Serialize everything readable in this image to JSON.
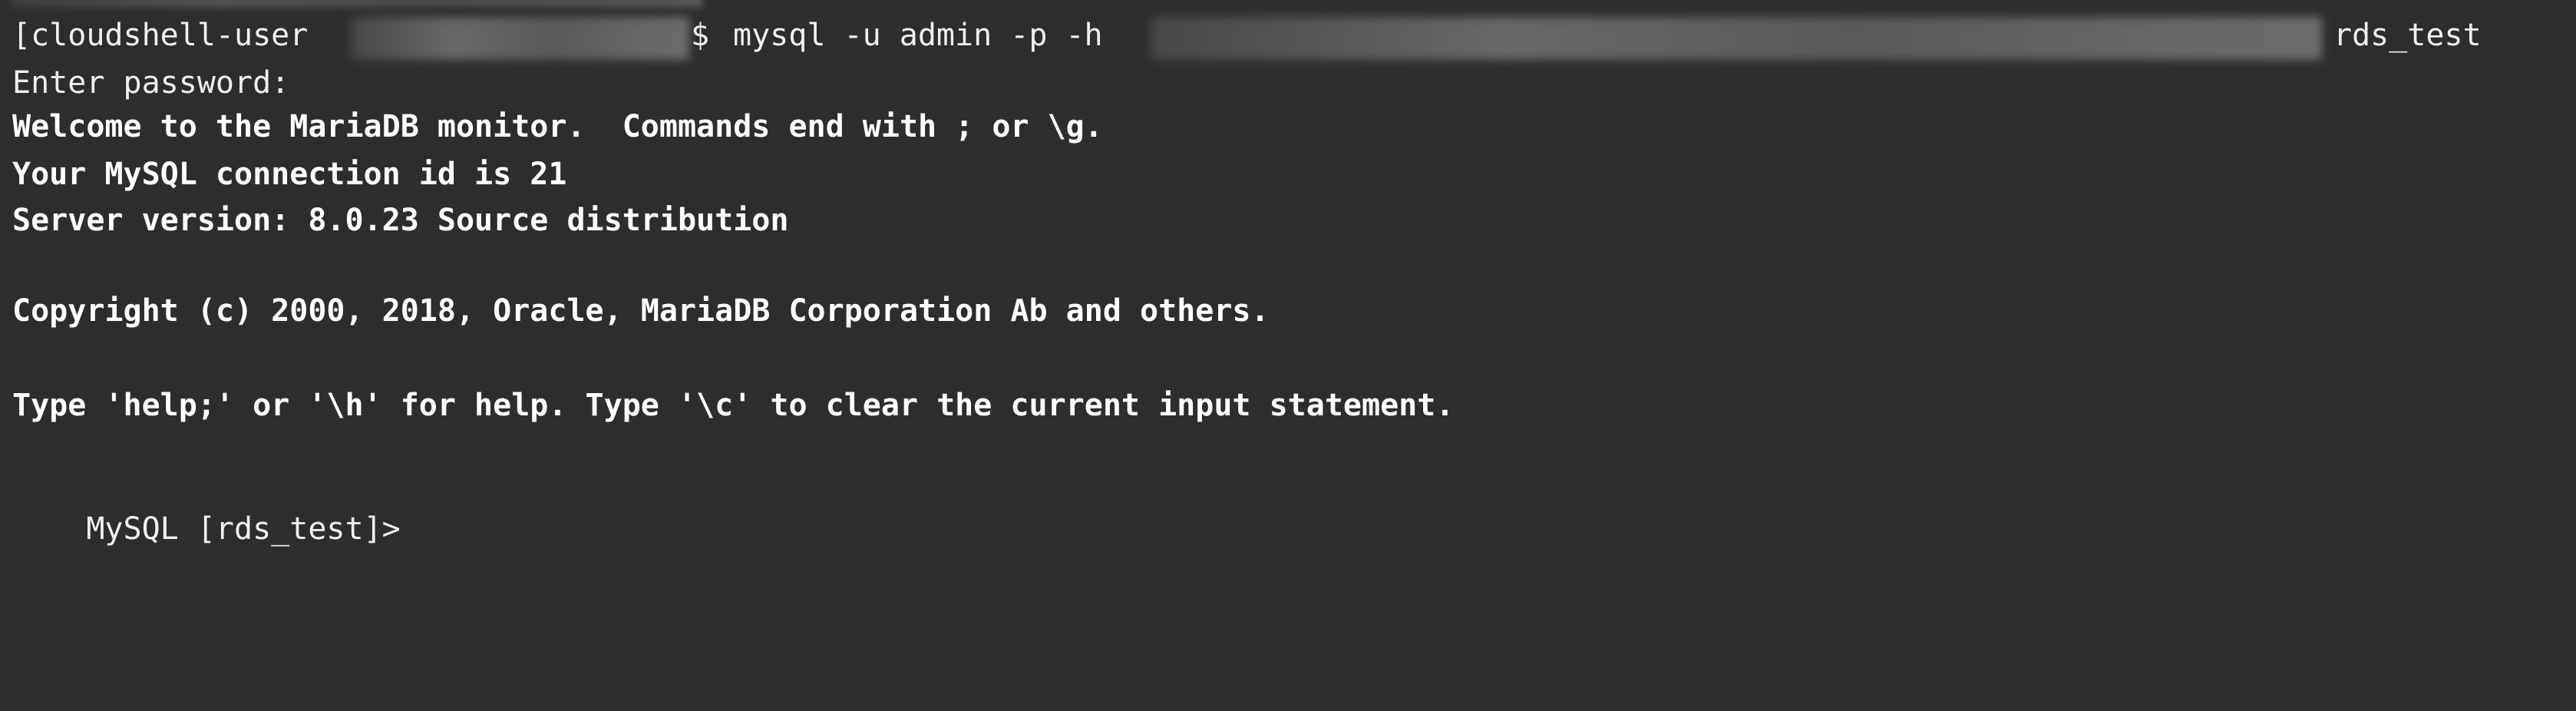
{
  "prompt_line": {
    "prefix": "[cloudshell-user",
    "dollar": "$",
    "command": "mysql -u admin -p -h",
    "database_arg": "rds_test"
  },
  "output": {
    "enter_password": "Enter password:",
    "welcome": "Welcome to the MariaDB monitor.  Commands end with ; or \\g.",
    "connection_id": "Your MySQL connection id is 21",
    "server_version": "Server version: 8.0.23 Source distribution",
    "copyright": "Copyright (c) 2000, 2018, Oracle, MariaDB Corporation Ab and others.",
    "help": "Type 'help;' or '\\h' for help. Type '\\c' to clear the current input statement."
  },
  "mysql_prompt": "MySQL [rds_test]>",
  "colors": {
    "background": "#2d2d2d",
    "text": "#f0f0f0"
  }
}
